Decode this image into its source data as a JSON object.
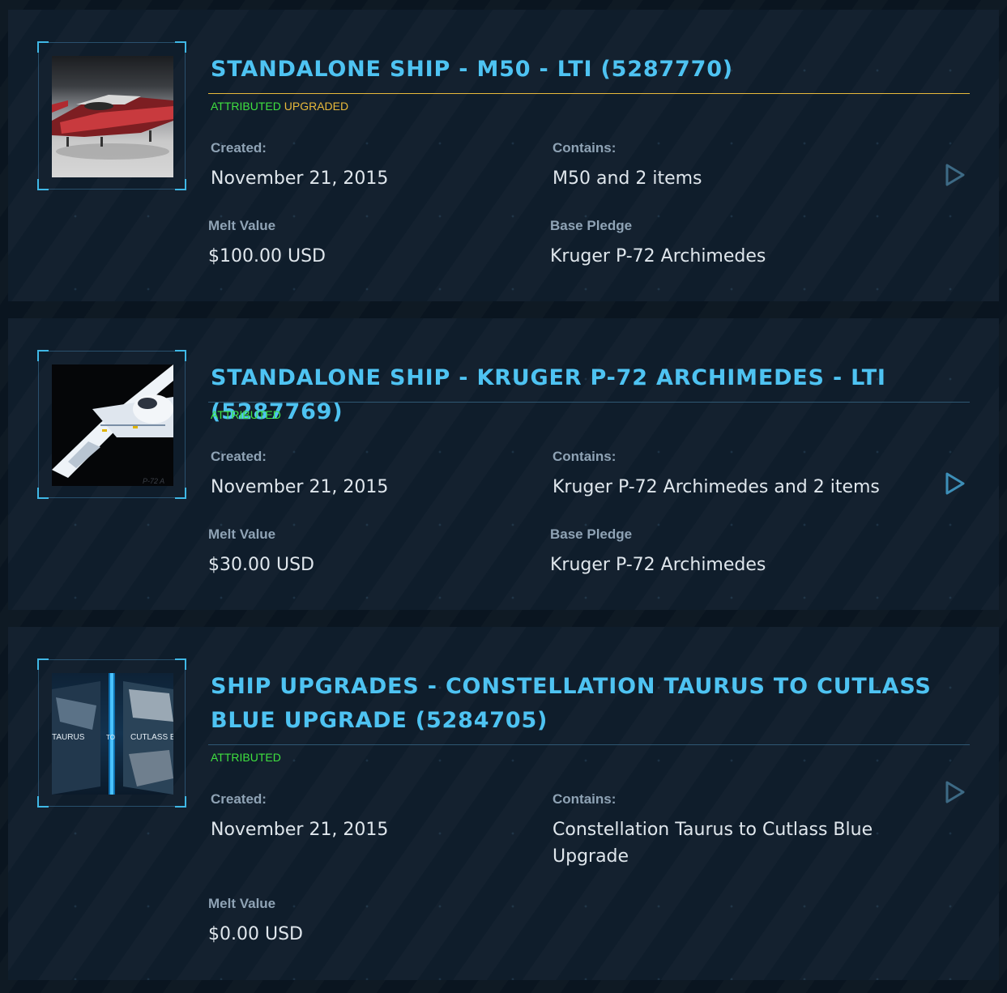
{
  "pledges": [
    {
      "title": "STANDALONE SHIP - M50 - LTI (5287770)",
      "statuses": [
        {
          "text": "ATTRIBUTED",
          "color": "#3fe13f"
        },
        {
          "text": "UPGRADED",
          "color": "#e8b93b"
        }
      ],
      "rule_color": "#e8b93b",
      "created_label": "Created:",
      "created": "November 21, 2015",
      "contains_label": "Contains:",
      "contains": "M50 and 2 items",
      "melt_label": "Melt Value",
      "melt": "$100.00 USD",
      "base_label": "Base Pledge",
      "base": "Kruger P-72 Archimedes",
      "thumbnail": "m50-ship-image",
      "expand_icon": "play-icon"
    },
    {
      "title": "STANDALONE SHIP - KRUGER P-72 ARCHIMEDES - LTI (5287769)",
      "statuses": [
        {
          "text": "ATTRIBUTED",
          "color": "#3fe13f"
        }
      ],
      "rule_color": "#2f5873",
      "created_label": "Created:",
      "created": "November 21, 2015",
      "contains_label": "Contains:",
      "contains": "Kruger P-72 Archimedes and 2 items",
      "melt_label": "Melt Value",
      "melt": "$30.00 USD",
      "base_label": "Base Pledge",
      "base": "Kruger P-72 Archimedes",
      "thumbnail": "p72-ship-image",
      "thumbnail_caption": "P-72 A",
      "expand_icon": "play-icon"
    },
    {
      "title": "SHIP UPGRADES - CONSTELLATION TAURUS TO CUTLASS BLUE UPGRADE (5284705)",
      "statuses": [
        {
          "text": "ATTRIBUTED",
          "color": "#3fe13f"
        }
      ],
      "rule_color": "#2f5873",
      "created_label": "Created:",
      "created": "November 21, 2015",
      "contains_label": "Contains:",
      "contains": "Constellation Taurus to Cutlass Blue Upgrade",
      "melt_label": "Melt Value",
      "melt": "$0.00 USD",
      "thumbnail": "upgrade-image",
      "thumbnail_text": {
        "from": "TAURUS",
        "to": "TO",
        "target": "CUTLASS B"
      },
      "expand_icon": "play-icon"
    }
  ]
}
